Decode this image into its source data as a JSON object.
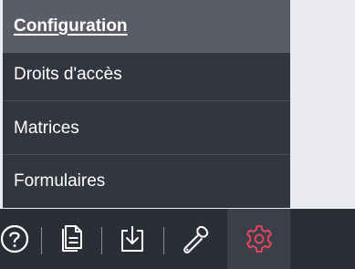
{
  "menu": {
    "items": [
      {
        "label": "Configuration",
        "active": true
      },
      {
        "label": "Droits d'accès",
        "active": false
      },
      {
        "label": "Matrices",
        "active": false
      },
      {
        "label": "Formulaires",
        "active": false
      }
    ]
  },
  "bottom_bar": {
    "buttons": [
      {
        "icon": "help-icon"
      },
      {
        "icon": "document-icon"
      },
      {
        "icon": "download-icon"
      },
      {
        "icon": "wrench-icon"
      },
      {
        "icon": "gear-icon",
        "selected": true
      }
    ]
  },
  "colors": {
    "menu_bg": "#33353f",
    "menu_active_bg": "#5a5c68",
    "bar_bg": "#2c2e37",
    "icon_white": "#ffffff",
    "icon_accent": "#e0475e",
    "page_bg": "#e9ebf1"
  }
}
